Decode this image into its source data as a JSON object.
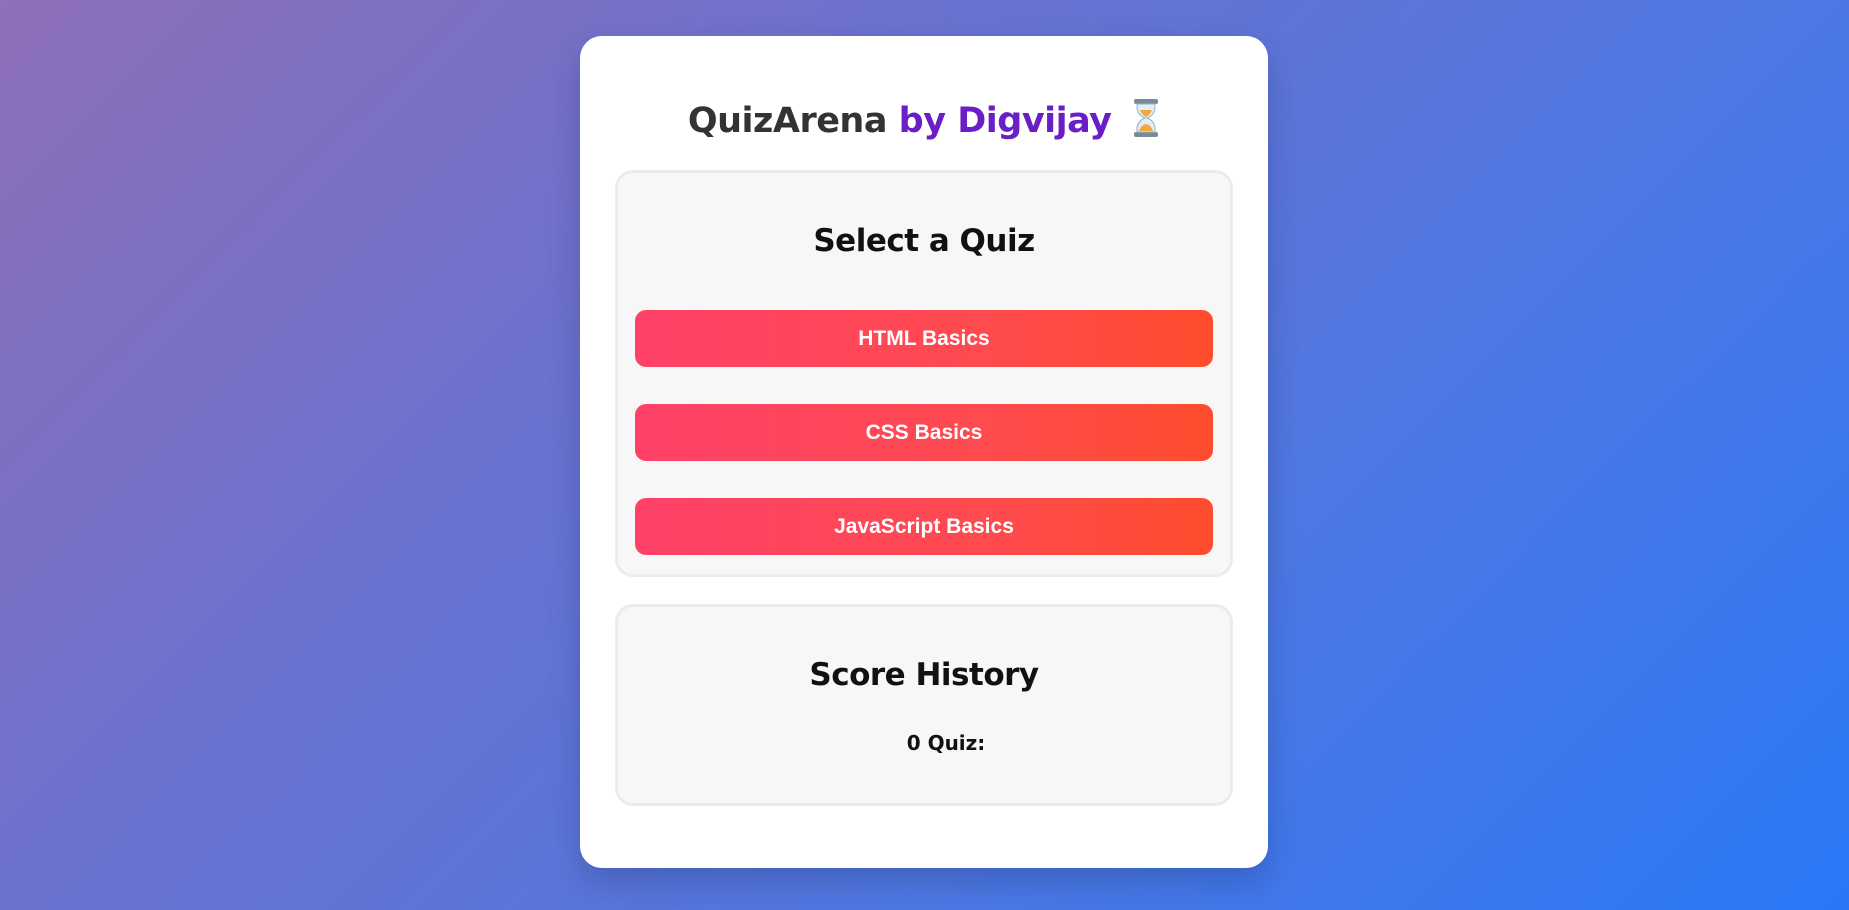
{
  "header": {
    "title_main": "QuizArena",
    "title_accent": "by Digvijay",
    "icon": "hourglass-icon"
  },
  "quiz_select": {
    "heading": "Select a Quiz",
    "buttons": [
      {
        "label": "HTML Basics"
      },
      {
        "label": "CSS Basics"
      },
      {
        "label": "JavaScript Basics"
      }
    ]
  },
  "score_history": {
    "heading": "Score History",
    "entry": "0 Quiz:"
  },
  "colors": {
    "accent": "#6a1fc6",
    "button_start": "#ff4169",
    "button_end": "#ff4c2d",
    "background_start": "#8e6fb8",
    "background_end": "#2a78f7"
  }
}
